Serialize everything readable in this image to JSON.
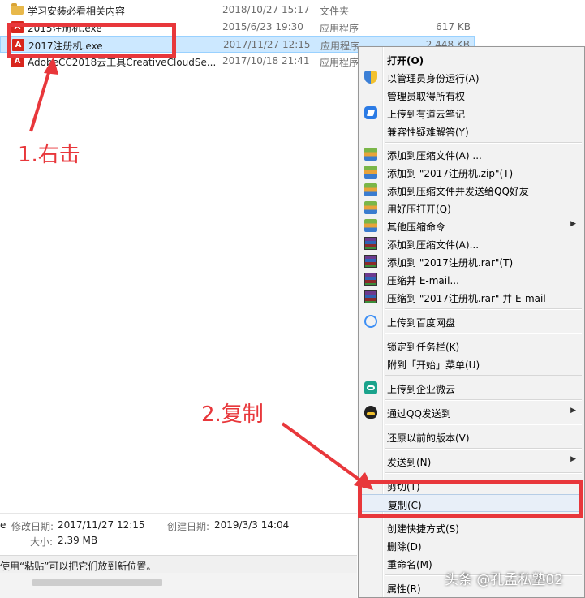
{
  "files": [
    {
      "name": "学习安装必看相关内容",
      "date": "2018/10/27 15:17",
      "type": "文件夹",
      "size": "",
      "icon": "folder-icon"
    },
    {
      "name": "2015注册机.exe",
      "date": "2015/6/23 19:30",
      "type": "应用程序",
      "size": "617 KB",
      "icon": "adobe-icon"
    },
    {
      "name": "2017注册机.exe",
      "date": "2017/11/27 12:15",
      "type": "应用程序",
      "size": "2,448 KB",
      "icon": "adobe-icon"
    },
    {
      "name": "AdobeCC2018云工具CreativeCloudSe...",
      "date": "2017/10/18 21:41",
      "type": "应用程序",
      "size": "",
      "icon": "adobe-icon"
    }
  ],
  "details": {
    "name_suffix": "e",
    "modified_label": "修改日期:",
    "modified_value": "2017/11/27 12:15",
    "created_label": "创建日期:",
    "created_value": "2019/3/3 14:04",
    "size_label": "大小:",
    "size_value": "2.39 MB"
  },
  "status": {
    "text": "使用“粘贴”可以把它们放到新位置。"
  },
  "context_menu": {
    "items": [
      {
        "label": "打开(O)",
        "icon": "",
        "bold": true
      },
      {
        "label": "以管理员身份运行(A)",
        "icon": "shield-icon"
      },
      {
        "label": "管理员取得所有权",
        "icon": ""
      },
      {
        "label": "上传到有道云笔记",
        "icon": "youdao-note-icon"
      },
      {
        "label": "兼容性疑难解答(Y)",
        "icon": ""
      },
      {
        "label": "添加到压缩文件(A) ...",
        "icon": "zip-icon"
      },
      {
        "label": "添加到 \"2017注册机.zip\"(T)",
        "icon": "zip-icon"
      },
      {
        "label": "添加到压缩文件并发送给QQ好友",
        "icon": "zip-icon"
      },
      {
        "label": "用好压打开(Q)",
        "icon": "zip-icon"
      },
      {
        "label": "其他压缩命令",
        "icon": "zip-icon",
        "submenu": true
      },
      {
        "label": "添加到压缩文件(A)...",
        "icon": "winrar-icon"
      },
      {
        "label": "添加到 \"2017注册机.rar\"(T)",
        "icon": "winrar-icon"
      },
      {
        "label": "压缩并 E-mail...",
        "icon": "winrar-icon"
      },
      {
        "label": "压缩到 \"2017注册机.rar\" 并 E-mail",
        "icon": "winrar-icon"
      },
      {
        "label": "上传到百度网盘",
        "icon": "baidu-netdisk-icon"
      },
      {
        "label": "锁定到任务栏(K)",
        "icon": ""
      },
      {
        "label": "附到「开始」菜单(U)",
        "icon": ""
      },
      {
        "label": "上传到企业微云",
        "icon": "weiyun-icon"
      },
      {
        "label": "通过QQ发送到",
        "icon": "qq-icon",
        "submenu": true
      },
      {
        "label": "还原以前的版本(V)",
        "icon": ""
      },
      {
        "label": "发送到(N)",
        "icon": "",
        "submenu": true
      },
      {
        "label": "剪切(T)",
        "icon": ""
      },
      {
        "label": "复制(C)",
        "icon": "",
        "highlighted": true
      },
      {
        "label": "创建快捷方式(S)",
        "icon": ""
      },
      {
        "label": "删除(D)",
        "icon": ""
      },
      {
        "label": "重命名(M)",
        "icon": ""
      },
      {
        "label": "属性(R)",
        "icon": ""
      }
    ],
    "submenu_arrow": "▶"
  },
  "annotations": {
    "step1": "1.右击",
    "step2": "2.复制",
    "color": "#e8373b"
  },
  "watermark": "头条 @孔孟私塾02"
}
